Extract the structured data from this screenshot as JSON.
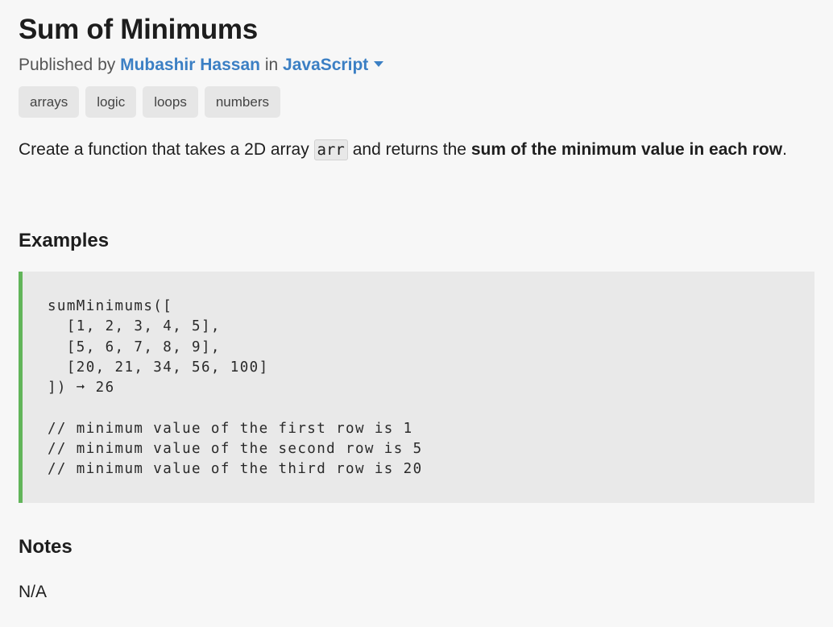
{
  "challenge": {
    "title": "Sum of Minimums",
    "byline": {
      "published_by": "Published by",
      "author": "Mubashir Hassan",
      "in": "in",
      "language": "JavaScript"
    },
    "tags": [
      "arrays",
      "logic",
      "loops",
      "numbers"
    ],
    "description": {
      "part1": "Create a function that takes a 2D array",
      "code": "arr",
      "part2": "and returns the",
      "bold": "sum of the minimum value in each row",
      "end": "."
    }
  },
  "examples": {
    "heading": "Examples",
    "code": "sumMinimums([\n  [1, 2, 3, 4, 5],\n  [5, 6, 7, 8, 9],\n  [20, 21, 34, 56, 100]\n]) ➞ 26\n\n// minimum value of the first row is 1\n// minimum value of the second row is 5\n// minimum value of the third row is 20"
  },
  "notes": {
    "heading": "Notes",
    "text": "N/A"
  },
  "colors": {
    "link": "#3b7fc4",
    "code_accent": "#62b55a",
    "background": "#f7f7f7"
  }
}
